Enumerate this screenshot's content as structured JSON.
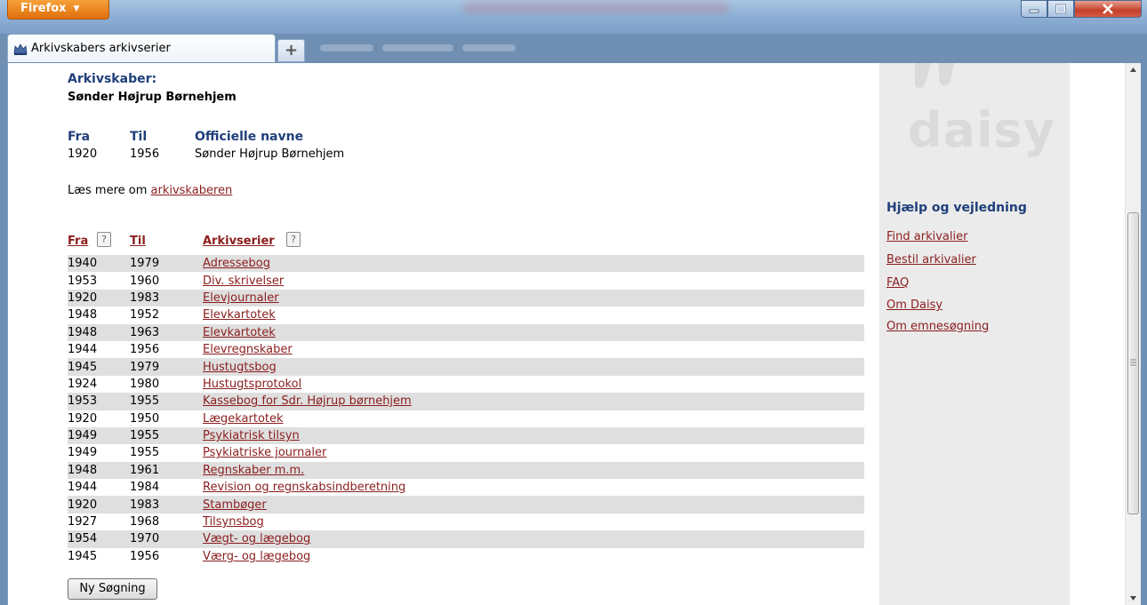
{
  "window": {
    "app_button_label": "Firefox"
  },
  "tabs": [
    {
      "label": "Arkivskabers arkivserier"
    }
  ],
  "creator": {
    "label": "Arkivskaber:",
    "name": "Sønder Højrup Børnehjem"
  },
  "official_names": {
    "headers": {
      "fra": "Fra",
      "til": "Til",
      "names": "Officielle navne"
    },
    "rows": [
      {
        "fra": "1920",
        "til": "1956",
        "name": "Sønder Højrup Børnehjem"
      }
    ]
  },
  "read_more": {
    "prefix": "Læs mere om ",
    "link": "arkivskaberen"
  },
  "series": {
    "headers": {
      "fra": "Fra",
      "til": "Til",
      "series": "Arkivserier"
    },
    "help_glyph": "?",
    "rows": [
      {
        "fra": "1940",
        "til": "1979",
        "title": "Adressebog"
      },
      {
        "fra": "1953",
        "til": "1960",
        "title": "Div. skrivelser"
      },
      {
        "fra": "1920",
        "til": "1983",
        "title": "Elevjournaler"
      },
      {
        "fra": "1948",
        "til": "1952",
        "title": "Elevkartotek"
      },
      {
        "fra": "1948",
        "til": "1963",
        "title": "Elevkartotek"
      },
      {
        "fra": "1944",
        "til": "1956",
        "title": "Elevregnskaber"
      },
      {
        "fra": "1945",
        "til": "1979",
        "title": "Hustugtsbog"
      },
      {
        "fra": "1924",
        "til": "1980",
        "title": "Hustugtsprotokol"
      },
      {
        "fra": "1953",
        "til": "1955",
        "title": "Kassebog for Sdr. Højrup børnehjem"
      },
      {
        "fra": "1920",
        "til": "1950",
        "title": "Lægekartotek"
      },
      {
        "fra": "1949",
        "til": "1955",
        "title": "Psykiatrisk tilsyn"
      },
      {
        "fra": "1949",
        "til": "1955",
        "title": "Psykiatriske journaler"
      },
      {
        "fra": "1948",
        "til": "1961",
        "title": "Regnskaber m.m."
      },
      {
        "fra": "1944",
        "til": "1984",
        "title": "Revision og regnskabsindberetning"
      },
      {
        "fra": "1920",
        "til": "1983",
        "title": "Stambøger"
      },
      {
        "fra": "1927",
        "til": "1968",
        "title": "Tilsynsbog"
      },
      {
        "fra": "1954",
        "til": "1970",
        "title": "Vægt- og lægebog"
      },
      {
        "fra": "1945",
        "til": "1956",
        "title": "Værg- og lægebog"
      }
    ]
  },
  "new_search_label": "Ny Søgning",
  "sidebar": {
    "logo": "daisy",
    "help_title": "Hjælp og vejledning",
    "links": [
      "Find arkivalier",
      "Bestil arkivalier",
      "FAQ",
      "Om Daisy",
      "Om emnesøgning"
    ]
  },
  "colors": {
    "heading_blue": "#1f3f7a",
    "link_red": "#8b1d1d",
    "row_shade": "#dfdfdf",
    "sidebar_bg": "#ebebeb",
    "firefox_orange": "#e87d1e"
  }
}
